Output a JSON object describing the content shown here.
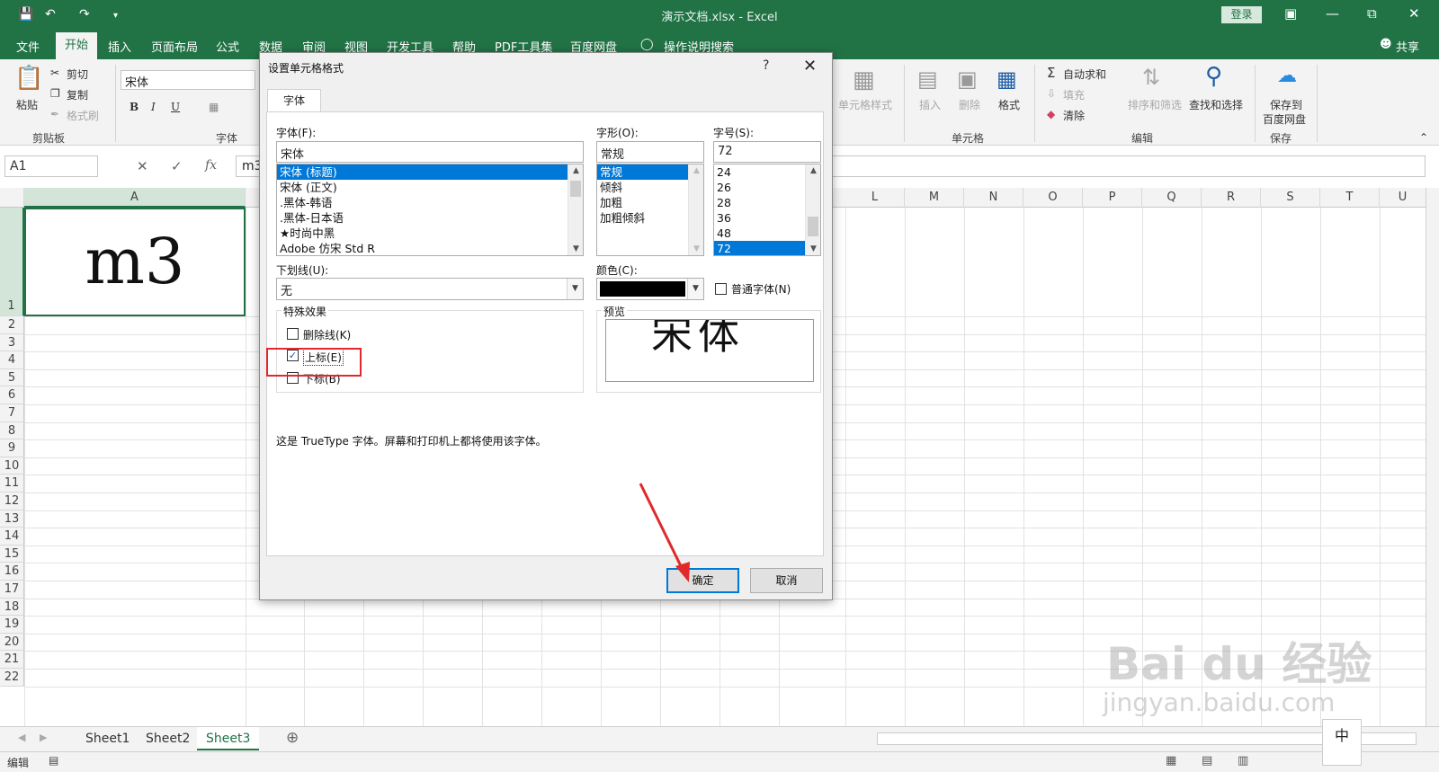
{
  "window": {
    "title": "演示文档.xlsx  -  Excel",
    "login": "登录",
    "share": "共享"
  },
  "ribbon_tabs": [
    "文件",
    "开始",
    "插入",
    "页面布局",
    "公式",
    "数据",
    "审阅",
    "视图",
    "开发工具",
    "帮助",
    "PDF工具集",
    "百度网盘"
  ],
  "tell_me": "操作说明搜索",
  "ribbon": {
    "paste": "粘贴",
    "cut": "剪切",
    "copy": "复制",
    "format_painter": "格式刷",
    "clipboard": "剪贴板",
    "font_name": "宋体",
    "font_group": "字体",
    "bold": "B",
    "italic": "I",
    "underline": "U",
    "cell_style": "单元格样式",
    "insert": "插入",
    "delete": "删除",
    "format": "格式",
    "cells_group": "单元格",
    "autosum": "自动求和",
    "fill": "填充",
    "clear": "清除",
    "sort_filter": "排序和筛选",
    "find_select": "查找和选择",
    "edit_group": "编辑",
    "save_to_line1": "保存到",
    "save_to_line2": "百度网盘",
    "save_group": "保存"
  },
  "formula_bar": {
    "name_box": "A1",
    "content": "m3",
    "fx": "fx"
  },
  "columns": [
    "A",
    "L",
    "M",
    "N",
    "O",
    "P",
    "Q",
    "R",
    "S",
    "T",
    "U"
  ],
  "rows": [
    "1",
    "2",
    "3",
    "4",
    "5",
    "6",
    "7",
    "8",
    "9",
    "10",
    "11",
    "12",
    "13",
    "14",
    "15",
    "16",
    "17",
    "18",
    "19",
    "20",
    "21",
    "22"
  ],
  "cell_a1": "m3",
  "sheets": [
    "Sheet1",
    "Sheet2",
    "Sheet3"
  ],
  "status": "编辑",
  "dialog": {
    "title": "设置单元格格式",
    "help": "?",
    "close": "✕",
    "tab": "字体",
    "font_label": "字体(F):",
    "font_value": "宋体",
    "font_list": [
      "宋体 (标题)",
      "宋体 (正文)",
      ".黑体-韩语",
      ".黑体-日本语",
      "★时尚中黑",
      "Adobe 仿宋 Std R"
    ],
    "style_label": "字形(O):",
    "style_value": "常规",
    "style_list": [
      "常规",
      "倾斜",
      "加粗",
      "加粗倾斜"
    ],
    "size_label": "字号(S):",
    "size_value": "72",
    "size_list": [
      "24",
      "26",
      "28",
      "36",
      "48",
      "72"
    ],
    "underline_label": "下划线(U):",
    "underline_value": "无",
    "color_label": "颜色(C):",
    "color_value": "#000000",
    "normal_font": "普通字体(N)",
    "effects_label": "特殊效果",
    "strikethrough": "删除线(K)",
    "superscript": "上标(E)",
    "subscript": "下标(B)",
    "superscript_checked": true,
    "preview_label": "预览",
    "preview_text": "宋体",
    "note": "这是 TrueType 字体。屏幕和打印机上都将使用该字体。",
    "ok": "确定",
    "cancel": "取消"
  },
  "watermark": {
    "line1": "Bai du 经验",
    "line2": "jingyan.baidu.com",
    "ime": "中"
  }
}
